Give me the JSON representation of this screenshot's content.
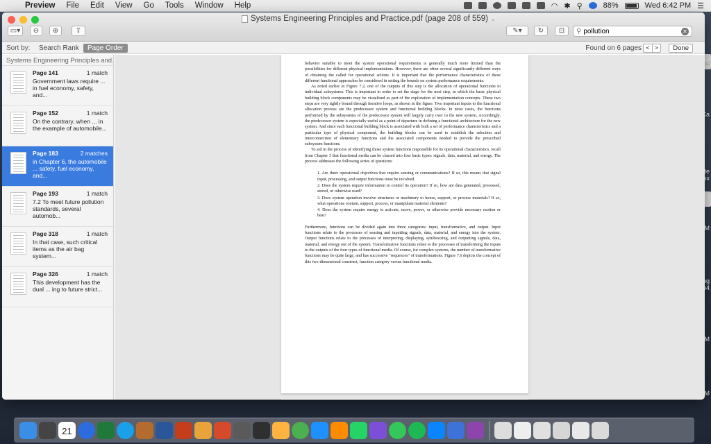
{
  "menubar": {
    "app": "Preview",
    "items": [
      "File",
      "Edit",
      "View",
      "Go",
      "Tools",
      "Window",
      "Help"
    ],
    "battery": "88%",
    "clock": "Wed 6:42 PM"
  },
  "window": {
    "title": "Systems Engineering Principles and Practice.pdf (page 208 of 559)",
    "search": {
      "value": "pollution"
    }
  },
  "results_bar": {
    "sort_by": "Sort by:",
    "search_rank": "Search Rank",
    "page_order": "Page Order",
    "found": "Found on 6 pages",
    "prev": "<",
    "next": ">",
    "done": "Done"
  },
  "sidebar": {
    "header": "Systems Engineering Principles and...",
    "results": [
      {
        "page": "Page 141",
        "count": "1 match",
        "snippet": "Government laws require ... in fuel economy, safety, and..."
      },
      {
        "page": "Page 152",
        "count": "1 match",
        "snippet": "On the contrary, when ... in the example of automobile..."
      },
      {
        "page": "Page 183",
        "count": "2 matches",
        "snippet": "in Chapter 6, the automobile ... safety, fuel economy, and..."
      },
      {
        "page": "Page 193",
        "count": "1 match",
        "snippet": "7.2 To meet future pollution standards, several automob..."
      },
      {
        "page": "Page 318",
        "count": "1 match",
        "snippet": "In that case, such critical items as the air bag system..."
      },
      {
        "page": "Page 326",
        "count": "1 match",
        "snippet": "This development has the dual ... ing to future strict..."
      }
    ]
  },
  "document": {
    "p1": "behavior suitable to meet the system operational requirements is generally much more limited than the possibilities for different physical implementations. However, there are often several significantly different ways of obtaining the called for operational actions. It is important that the performance characteristics of these different functional approaches be considered in setting the bounds on system performance requirements.",
    "p2": "As noted earlier in Figure 7.2, one of the outputs of this step is the allocation of operational functions to individual subsystems. This is important in order to set the stage for the next step, in which the basic physical building block components may be visualized as part of the exploration of implementation concepts. These two steps are very tightly bound through iterative loops, as shown in the figure. Two important inputs to the functional allocation process are the predecessor system and functional building blocks. In most cases, the functions performed by the subsystems of the predecessor system will largely carry over to the new system. Accordingly, the predecessor system is especially useful as a point of departure in defining a functional architecture for the new system. And since each functional building block is associated with both a set of performance characteristics and a particular type of physical component, the building blocks can be used to establish the selection and interconnection of elementary functions and the associated components needed to provide the prescribed subsystem functions.",
    "p3": "To aid in the process of identifying those system functions responsible for its operational characteristics, recall from Chapter 3 that functional media can be classed into four basic types: signals, data, material, and energy. The process addresses the following series of questions:",
    "list": [
      "1. Are there operational objectives that require sensing or communications? If so, this means that signal input, processing, and output functions must be involved.",
      "2. Does the system require information to control its operation? If so, how are data generated, processed, stored, or otherwise used?",
      "3. Does system operation involve structures or machinery to house, support, or process materials? If so, what operations contain, support, process, or manipulate material elements?",
      "4. Does the system require energy to activate, move, power, or otherwise provide necessary motion or heat?"
    ],
    "p4": "Furthermore, functions can be divided again into three categories: input, transformative, and output. Input functions relate to the processes of sensing and inputting signals, data, material, and energy into the system. Output functions relate to the processes of interpreting, displaying, synthesizing, and outputting signals, data, material, and energy out of the system. Transformative functions relate to the processes of transforming the inputs to the outputs of the four types of functional media. Of course, for complex systems, the number of transformative functions may be quite large, and has successive \"sequences\" of transformations. Figure 7.6 depicts the concept of this two-dimensional construct, function category versus functional media."
  },
  "desktop": {
    "labels": [
      "AM",
      "Ca",
      "sate",
      "li.xlsx",
      "AM",
      "ding",
      "2.mp4",
      "PM",
      "PM"
    ]
  },
  "dock": {
    "calendar_day": "21",
    "colors": [
      "#3a8ee6",
      "#444",
      "#3a3a3a",
      "#2d6cdf",
      "#1f7a3a",
      "#1aa0e8",
      "#b36b2e",
      "#2b579a",
      "#c43e1c",
      "#e8a33a",
      "#d44a2a",
      "#5a5a5a",
      "#2f2f2f",
      "#ffb340",
      "#4caf50",
      "#1e90ff",
      "#ff8c00",
      "#25d366",
      "#7b4fd8",
      "#34c759",
      "#1db954",
      "#0b84ff",
      "#3d73d8",
      "#8e44ad",
      "#ddd",
      "#eee",
      "#e0e0e0",
      "#d6d6d6",
      "#e8e8e8",
      "#dadada"
    ]
  }
}
